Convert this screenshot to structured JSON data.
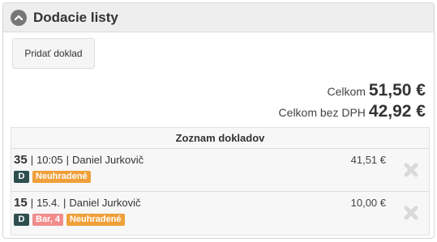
{
  "panel": {
    "title": "Dodacie listy"
  },
  "actions": {
    "add_document_label": "Pridať doklad"
  },
  "totals": {
    "total_label": "Celkom",
    "total_value": "51,50 €",
    "total_excl_vat_label": "Celkom bez DPH",
    "total_excl_vat_value": "42,92 €"
  },
  "document_list": {
    "header": "Zoznam dokladov",
    "separator": "|",
    "items": [
      {
        "number": "35",
        "time": "10:05",
        "person": "Daniel Jurkovič",
        "amount": "41,51 €",
        "type_badge": "D",
        "status_badge": "Neuhradené",
        "colors": {
          "type_badge": "#2f4f4f",
          "status_badge": "#f0a03a"
        }
      },
      {
        "number": "15",
        "time": "15.4.",
        "person": "Daniel Jurkovič",
        "amount": "10,00 €",
        "type_badge": "D",
        "bar_badge": "Bar, 4",
        "status_badge": "Neuhradené",
        "colors": {
          "type_badge": "#2f4f4f",
          "bar_badge": "#f28c8c",
          "status_badge": "#f0a03a"
        }
      }
    ]
  },
  "icons": {
    "collapse": "chevron-up-circle-icon",
    "delete": "close-x-icon"
  }
}
